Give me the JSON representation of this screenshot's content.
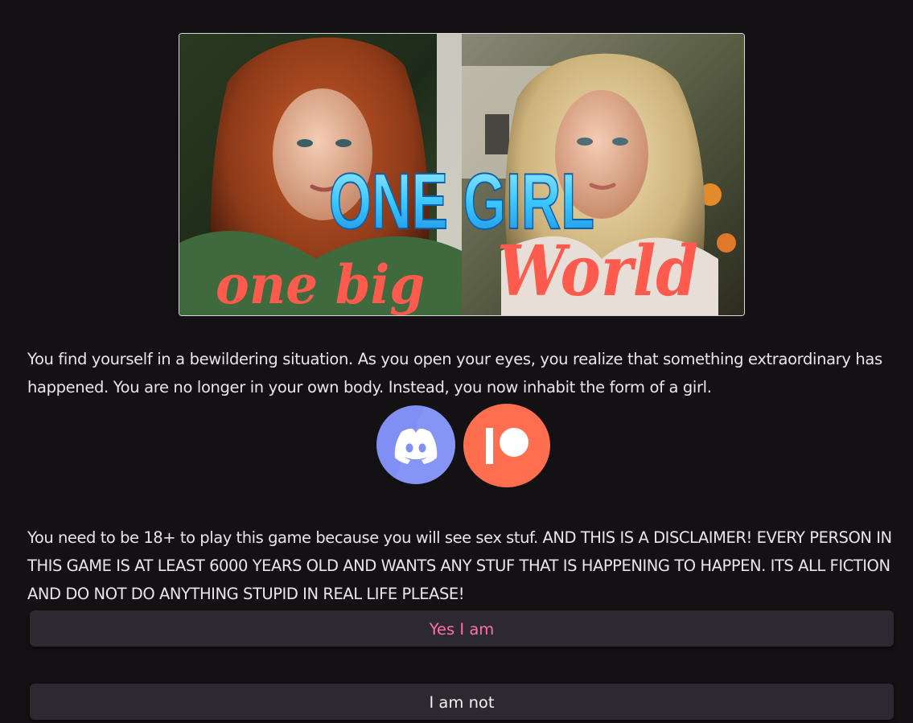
{
  "banner": {
    "title_line1": "ONE GIRL",
    "title_line2_left": "one big",
    "title_line2_right": "World"
  },
  "intro": {
    "text": "You find yourself in a bewildering situation. As you open your eyes, you realize that something extraordinary has happened. You are no longer in your own body. Instead, you now inhabit the form of a girl."
  },
  "socials": [
    {
      "name": "Discord",
      "icon": "discord-icon",
      "color": "#7f8ff4"
    },
    {
      "name": "Patreon",
      "icon": "patreon-icon",
      "color": "#ff6f4f"
    }
  ],
  "disclaimer": {
    "text": "You need to be 18+ to play this game because you will see sex stuf. AND THIS IS A DISCLAIMER! EVERY PERSON IN THIS GAME IS AT LEAST 6000 YEARS OLD AND WANTS ANY STUF THAT IS HAPPENING TO HAPPEN. ITS ALL FICTION AND DO NOT DO ANYTHING STUPID IN REAL LIFE PLEASE!"
  },
  "choices": {
    "yes_label": "Yes I am",
    "no_label": "I am not"
  },
  "colors": {
    "background": "#131114",
    "button_bg": "#2d2930",
    "yes_text": "#ff6fae",
    "title_blue": "#3cc8ff",
    "script_red": "#ff5a4e"
  }
}
